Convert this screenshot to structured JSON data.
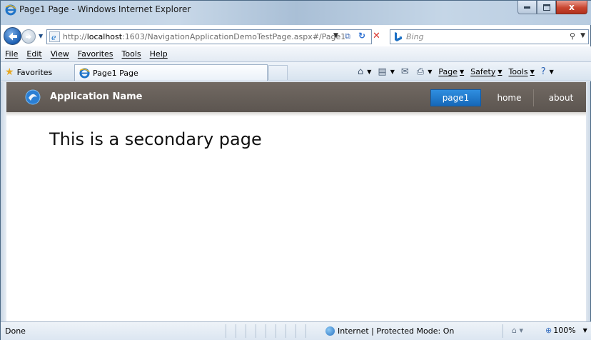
{
  "window": {
    "title": "Page1 Page - Windows Internet Explorer",
    "close_glyph": "x"
  },
  "address": {
    "url_prefix": "http://",
    "url_host": "localhost",
    "url_rest": ":1603/NavigationApplicationDemoTestPage.aspx#/Page1",
    "search_placeholder": "Bing"
  },
  "menu": {
    "items": [
      "File",
      "Edit",
      "View",
      "Favorites",
      "Tools",
      "Help"
    ]
  },
  "favorites_bar": {
    "favorites_label": "Favorites",
    "tab_title": "Page1 Page",
    "commands": {
      "page": "Page",
      "safety": "Safety",
      "tools": "Tools"
    }
  },
  "app": {
    "name": "Application Name",
    "nav": [
      {
        "label": "page1",
        "active": true
      },
      {
        "label": "home",
        "active": false
      },
      {
        "label": "about",
        "active": false
      }
    ],
    "heading": "This is a secondary page",
    "colors": {
      "header_bg": "#655e58",
      "active_nav": "#1f7ccf"
    }
  },
  "status": {
    "text": "Done",
    "zone": "Internet | Protected Mode: On",
    "zoom": "100%"
  }
}
